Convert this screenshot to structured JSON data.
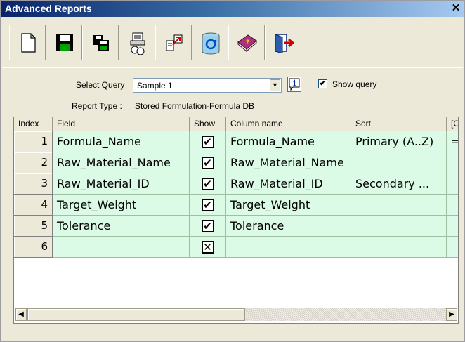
{
  "window": {
    "title": "Advanced Reports",
    "close_glyph": "✕"
  },
  "toolbar": {
    "buttons": [
      {
        "name": "new-report-icon"
      },
      {
        "name": "save-icon"
      },
      {
        "name": "save-as-icon"
      },
      {
        "name": "print-preview-icon"
      },
      {
        "name": "export-icon"
      },
      {
        "name": "database-refresh-icon"
      },
      {
        "name": "help-book-icon"
      },
      {
        "name": "exit-icon"
      }
    ]
  },
  "query": {
    "select_label": "Select Query",
    "selected": "Sample 1",
    "show_query_label": "Show query",
    "show_query_checked": true,
    "report_type_label": "Report Type :",
    "report_type_value": "Stored Formulation-Formula DB"
  },
  "grid": {
    "columns": [
      "Index",
      "Field",
      "Show",
      "Column name",
      "Sort",
      "[Ope"
    ],
    "rows": [
      {
        "index": "1",
        "field": "Formula_Name",
        "show": "✔",
        "column_name": "Formula_Name",
        "sort": "Primary (A..Z)",
        "op": "="
      },
      {
        "index": "2",
        "field": "Raw_Material_Name",
        "show": "✔",
        "column_name": "Raw_Material_Name",
        "sort": "",
        "op": ""
      },
      {
        "index": "3",
        "field": "Raw_Material_ID",
        "show": "✔",
        "column_name": "Raw_Material_ID",
        "sort": "Secondary ...",
        "op": ""
      },
      {
        "index": "4",
        "field": "Target_Weight",
        "show": "✔",
        "column_name": "Target_Weight",
        "sort": "",
        "op": ""
      },
      {
        "index": "5",
        "field": "Tolerance",
        "show": "✔",
        "column_name": "Tolerance",
        "sort": "",
        "op": ""
      },
      {
        "index": "6",
        "field": "",
        "show": "✕",
        "column_name": "",
        "sort": "",
        "op": ""
      }
    ]
  }
}
